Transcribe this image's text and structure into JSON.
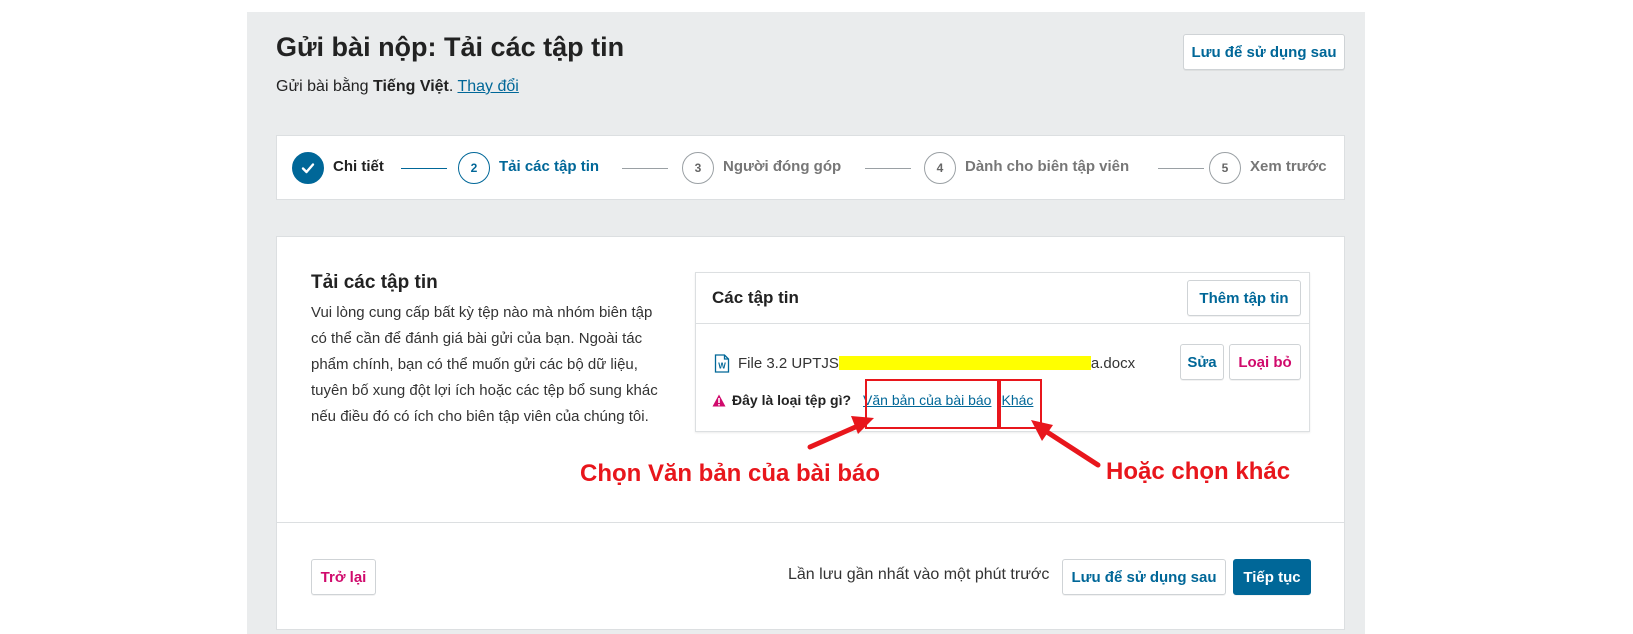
{
  "header": {
    "title": "Gửi bài nộp: Tải các tập tin",
    "lang_prefix": "Gửi bài bằng ",
    "lang_name": "Tiếng Việt",
    "lang_suffix": ". ",
    "change_link": "Thay đổi",
    "save_later_label": "Lưu để sử dụng sau"
  },
  "steps": [
    {
      "number": "1",
      "label": "Chi tiết",
      "state": "done"
    },
    {
      "number": "2",
      "label": "Tải các tập tin",
      "state": "active"
    },
    {
      "number": "3",
      "label": "Người đóng góp",
      "state": "pending"
    },
    {
      "number": "4",
      "label": "Dành cho biên tập viên",
      "state": "pending"
    },
    {
      "number": "5",
      "label": "Xem trước",
      "state": "pending"
    }
  ],
  "upload_section": {
    "title": "Tải các tập tin",
    "description": "Vui lòng cung cấp bất kỳ tệp nào mà nhóm biên tập có thể cần để đánh giá bài gửi của bạn. Ngoài tác phẩm chính, bạn có thể muốn gửi các bộ dữ liệu, tuyên bố xung đột lợi ích hoặc các tệp bổ sung khác nếu điều đó có ích cho biên tập viên của chúng tôi."
  },
  "files_panel": {
    "title": "Các tập tin",
    "add_button": "Thêm tập tin",
    "file": {
      "name_prefix": "File 3.2 UPTJS",
      "name_suffix": "a.docx",
      "edit_button": "Sửa",
      "remove_button": "Loại bỏ"
    },
    "type_prompt": "Đây là loại tệp gì?",
    "type_option_article": "Văn bản của bài báo",
    "type_option_other": "Khác"
  },
  "annotations": {
    "left_text": "Chọn Văn bản của bài báo",
    "right_text": "Hoặc chọn khác",
    "color": "#e8161c"
  },
  "footer": {
    "back_button": "Trở lại",
    "last_saved": "Lần lưu gần nhất vào một phút trước",
    "save_later_button": "Lưu để sử dụng sau",
    "continue_button": "Tiếp tục"
  },
  "icons": {
    "check": "check-icon",
    "file": "word-file-icon",
    "warning": "warning-icon"
  },
  "colors": {
    "primary": "#006798",
    "danger": "#d00a6c",
    "annotation": "#e8161c",
    "redaction": "#ffff00"
  }
}
